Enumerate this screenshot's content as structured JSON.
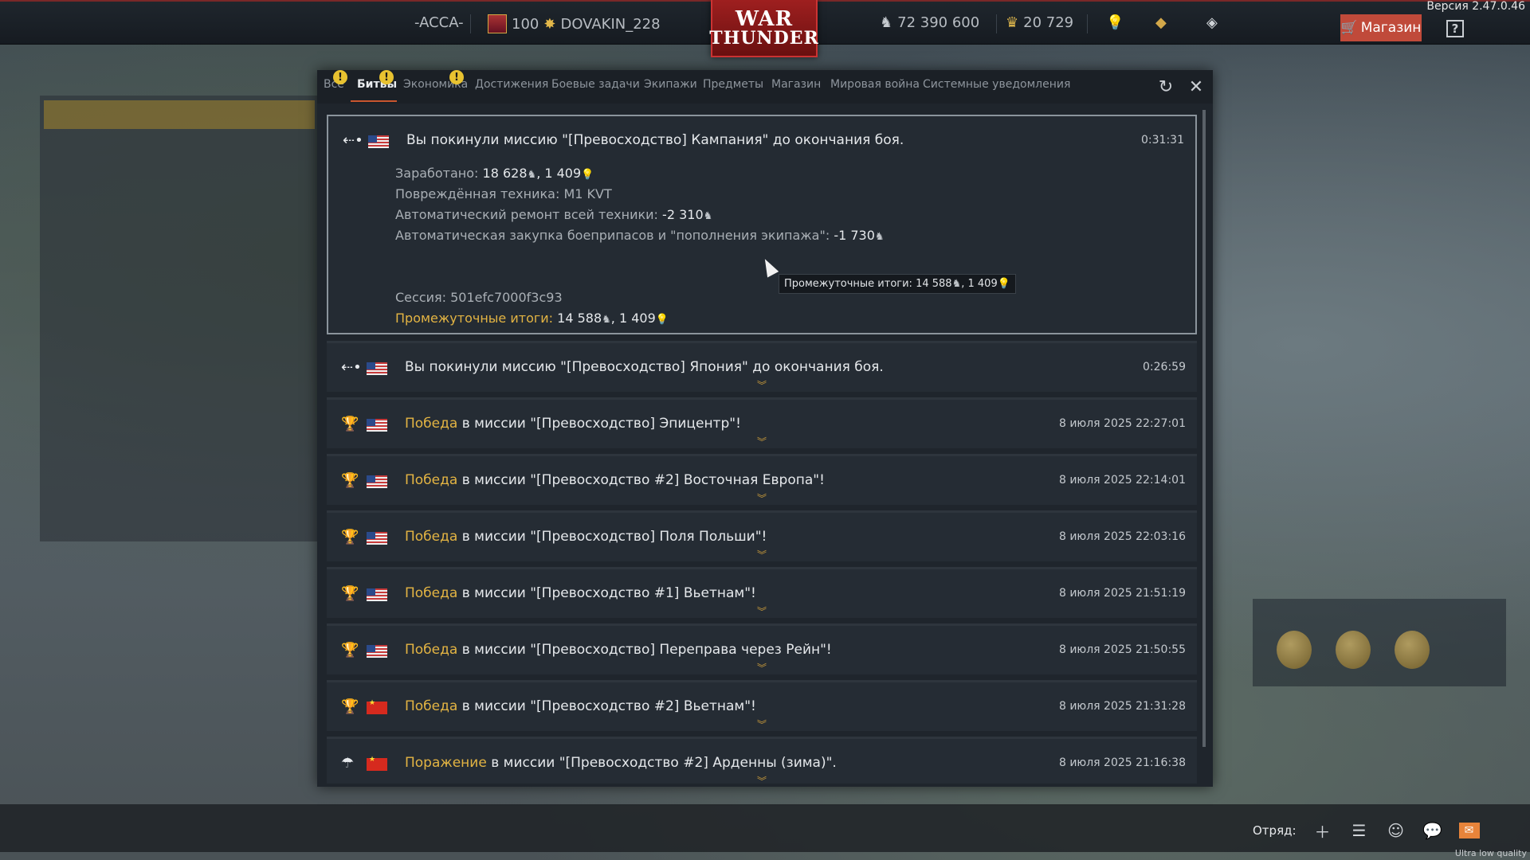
{
  "app": {
    "version": "Версия 2.47.0.46",
    "quality": "Ultra low quality",
    "logo_top": "WAR",
    "logo_bottom": "THUNDER"
  },
  "topbar": {
    "squadron": "-ACCA-",
    "level": "100",
    "nickname": "DOVAKIN_228",
    "silver_lions": "72 390 600",
    "golden_eagles": "20 729",
    "shop_label": "Магазин",
    "help_label": "?"
  },
  "window": {
    "tabs": [
      {
        "label": "Все",
        "alert": "!"
      },
      {
        "label": "Битвы",
        "alert": "!"
      },
      {
        "label": "Экономика",
        "alert": "!"
      },
      {
        "label": "Достижения"
      },
      {
        "label": "Боевые задачи"
      },
      {
        "label": "Экипажи"
      },
      {
        "label": "Предметы"
      },
      {
        "label": "Магазин"
      },
      {
        "label": "Мировая война"
      },
      {
        "label": "Системные уведомления"
      }
    ],
    "active_tab": "Битвы",
    "refresh_icon": "↻",
    "close_icon": "✕"
  },
  "entries": [
    {
      "icon": "left-mission-icon",
      "flag": "us",
      "title_plain": "Вы покинули миссию \"[Превосходство] Кампания\" до окончания боя.",
      "time": "0:31:31",
      "expanded": true,
      "details": {
        "earned_label": "Заработано:",
        "earned_value": "18 628",
        "earned_value2": ", 1 409",
        "damaged_label": "Повреждённая техника:",
        "damaged_value": "M1 KVT",
        "repair_label": "Автоматический ремонт всей техники:",
        "repair_value": "-2 310",
        "ammo_label": "Автоматическая закупка боеприпасов и \"пополнения экипажа\":",
        "ammo_value": "-1 730",
        "session_label": "Сессия:",
        "session_value": "501efc7000f3c93",
        "subtotal_label": "Промежуточные итоги:",
        "subtotal_value": "14 588",
        "subtotal_value2": ", 1 409"
      }
    },
    {
      "icon": "left-mission-icon",
      "flag": "us",
      "title_plain": "Вы покинули миссию \"[Превосходство] Япония\" до окончания боя.",
      "time": "0:26:59"
    },
    {
      "icon": "trophy-icon",
      "flag": "us",
      "hl": "Победа",
      "rest": " в миссии \"[Превосходство] Эпицентр\"!",
      "time": "8 июля 2025 22:27:01"
    },
    {
      "icon": "trophy-icon",
      "flag": "us",
      "hl": "Победа",
      "rest": " в миссии \"[Превосходство #2] Восточная Европа\"!",
      "time": "8 июля 2025 22:14:01"
    },
    {
      "icon": "trophy-icon",
      "flag": "us",
      "hl": "Победа",
      "rest": " в миссии \"[Превосходство] Поля Польши\"!",
      "time": "8 июля 2025 22:03:16"
    },
    {
      "icon": "trophy-icon",
      "flag": "us",
      "hl": "Победа",
      "rest": " в миссии \"[Превосходство #1] Вьетнам\"!",
      "time": "8 июля 2025 21:51:19"
    },
    {
      "icon": "trophy-icon",
      "flag": "us",
      "hl": "Победа",
      "rest": " в миссии \"[Превосходство] Переправа через Рейн\"!",
      "time": "8 июля 2025 21:50:55"
    },
    {
      "icon": "trophy-icon",
      "flag": "cn",
      "hl": "Победа",
      "rest": " в миссии \"[Превосходство #2] Вьетнам\"!",
      "time": "8 июля 2025 21:31:28"
    },
    {
      "icon": "parachute-icon",
      "flag": "cn",
      "hl": "Поражение",
      "rest": " в миссии \"[Превосходство #2] Арденны (зима)\".",
      "time": "8 июля 2025 21:16:38"
    }
  ],
  "tooltip": {
    "label": "Промежуточные итоги:",
    "value": "14 588",
    "value2": ", 1 409"
  },
  "bottom": {
    "squad_label": "Отряд:"
  },
  "colors": {
    "highlight": "#e3b443",
    "shop": "#c04a3a",
    "tab_underline": "#c9562e"
  }
}
